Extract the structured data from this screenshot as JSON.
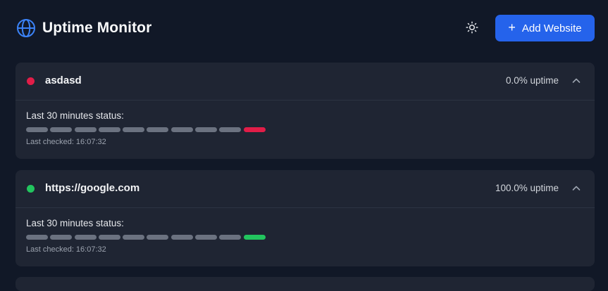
{
  "header": {
    "title": "Uptime Monitor",
    "logo_icon": "globe-icon",
    "theme_icon": "sun-icon",
    "add_button_label": "Add Website",
    "add_button_icon": "+"
  },
  "colors": {
    "accent": "#2563eb",
    "down": "#e11d48",
    "up": "#22c55e",
    "neutral": "#6b7280"
  },
  "monitors": [
    {
      "name": "asdasd",
      "status": "down",
      "uptime": "0.0% uptime",
      "status_label": "Last 30 minutes status:",
      "history": [
        "unknown",
        "unknown",
        "unknown",
        "unknown",
        "unknown",
        "unknown",
        "unknown",
        "unknown",
        "unknown",
        "down"
      ],
      "last_checked": "Last checked: 16:07:32"
    },
    {
      "name": "https://google.com",
      "status": "up",
      "uptime": "100.0% uptime",
      "status_label": "Last 30 minutes status:",
      "history": [
        "unknown",
        "unknown",
        "unknown",
        "unknown",
        "unknown",
        "unknown",
        "unknown",
        "unknown",
        "unknown",
        "up"
      ],
      "last_checked": "Last checked: 16:07:32"
    }
  ]
}
